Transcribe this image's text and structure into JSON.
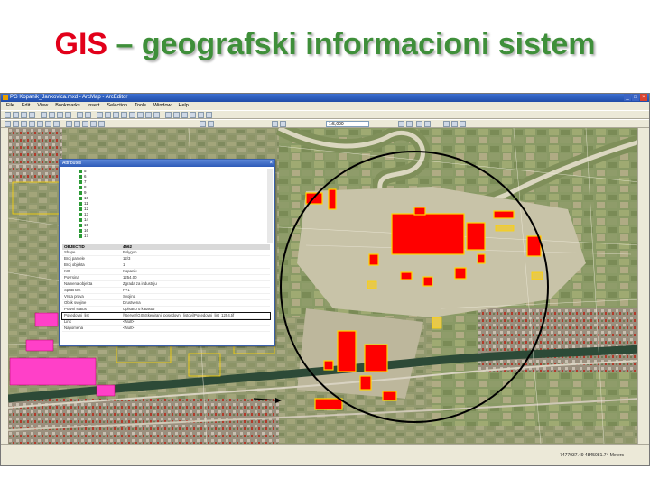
{
  "slide": {
    "title_prefix": "GIS",
    "title_rest": " – geografski informacioni sistem"
  },
  "window": {
    "title": "PG Kopanik_Jankovica.mxd - ArcMap - ArcEditor",
    "menu": [
      "File",
      "Edit",
      "View",
      "Bookmarks",
      "Insert",
      "Selection",
      "Tools",
      "Window",
      "Help"
    ],
    "scale_value": "1:5,000",
    "status_coords": "7477937.49 4845081.74 Meters"
  },
  "attributes": {
    "title": "Attributes",
    "tree_items": [
      "5",
      "6",
      "7",
      "8",
      "9",
      "10",
      "11",
      "12",
      "13",
      "14",
      "15",
      "16",
      "17"
    ],
    "header": {
      "field": "OBJECTID",
      "value": "4562"
    },
    "rows": [
      {
        "field": "Shape",
        "value": "Polygon"
      },
      {
        "field": "Broj parcele",
        "value": "12/3"
      },
      {
        "field": "Broj objekta",
        "value": "1"
      },
      {
        "field": "KO",
        "value": "Kopanik"
      },
      {
        "field": "Povrsina",
        "value": "1254.00"
      },
      {
        "field": "Namena objekta",
        "value": "Zgrada za industriju"
      },
      {
        "field": "Spratnost",
        "value": "P+1"
      },
      {
        "field": "Vrsta prava",
        "value": "Svojina"
      },
      {
        "field": "Oblik svojine",
        "value": "Drustvena"
      },
      {
        "field": "Pravni status",
        "value": "Upisano u katastar"
      },
      {
        "field": "Posedovni_list",
        "value": "\\\\Server\\GIS\\Skenirani_posedovni_listovi\\Posedovni_list_1254.tif"
      },
      {
        "field": "Link",
        "value": "<Null>"
      },
      {
        "field": "Napomena",
        "value": "<Null>"
      }
    ]
  },
  "colors": {
    "title_red": "#e2001a",
    "title_green": "#3f8f3a",
    "building_red": "#ff0000",
    "building_outline": "#ffd400",
    "parcel_pink": "#ff40c8"
  }
}
